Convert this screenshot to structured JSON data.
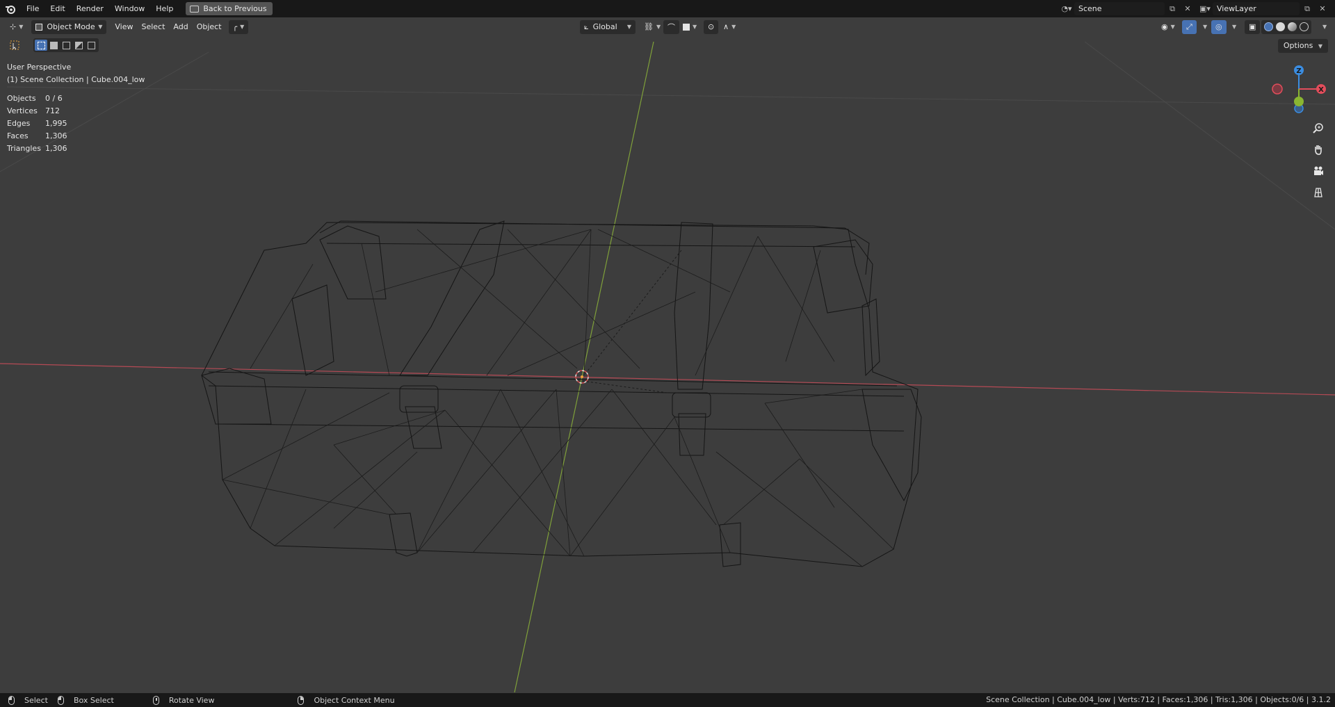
{
  "topbar": {
    "menus": [
      "File",
      "Edit",
      "Render",
      "Window",
      "Help"
    ],
    "back_label": "Back to Previous",
    "scene_name": "Scene",
    "view_layer_name": "ViewLayer"
  },
  "viewport_header": {
    "mode_label": "Object Mode",
    "menus": [
      "View",
      "Select",
      "Add",
      "Object"
    ],
    "orientation_label": "Global",
    "options_label": "Options"
  },
  "overlay_info": {
    "perspective": "User Perspective",
    "collection": "(1) Scene Collection | Cube.004_low"
  },
  "stats": [
    {
      "key": "Objects",
      "value": "0 / 6"
    },
    {
      "key": "Vertices",
      "value": "712"
    },
    {
      "key": "Edges",
      "value": "1,995"
    },
    {
      "key": "Faces",
      "value": "1,306"
    },
    {
      "key": "Triangles",
      "value": "1,306"
    }
  ],
  "gizmo": {
    "z_label": "Z",
    "x_label": "X",
    "x_color": "#e34d5b",
    "y_color": "#8ab631",
    "z_color": "#3b8de1"
  },
  "statusbar": {
    "select": "Select",
    "box_select": "Box Select",
    "rotate_view": "Rotate View",
    "context_menu": "Object Context Menu",
    "right_info": "Scene Collection | Cube.004_low | Verts:712 | Faces:1,306 | Tris:1,306 | Objects:0/6 | 3.1.2"
  },
  "colors": {
    "accent": "#4772b3",
    "x_axis": "#b54a55",
    "y_axis": "#7fa03a",
    "background": "#3d3d3d"
  }
}
